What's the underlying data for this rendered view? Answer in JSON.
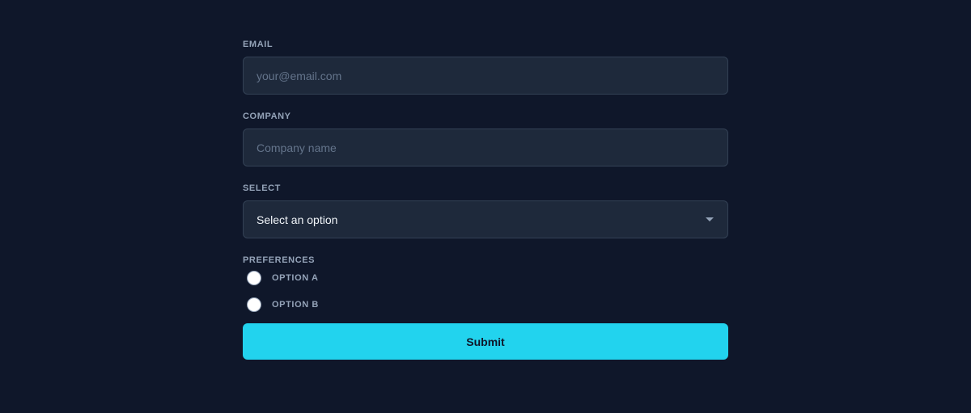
{
  "form": {
    "email": {
      "label": "EMAIL",
      "placeholder": "your@email.com",
      "value": ""
    },
    "company": {
      "label": "COMPANY",
      "placeholder": "Company name",
      "value": ""
    },
    "select": {
      "label": "SELECT",
      "selected": "Select an option",
      "icon": "chevron-down-icon"
    },
    "preferences": {
      "label": "PREFERENCES",
      "options": [
        {
          "label": "OPTION A",
          "checked": false
        },
        {
          "label": "OPTION B",
          "checked": false
        }
      ]
    },
    "submit_label": "Submit"
  },
  "colors": {
    "background": "#0f172a",
    "input_background": "#1e293b",
    "input_border": "#334155",
    "label": "#94a3b8",
    "accent": "#22d3ee"
  }
}
